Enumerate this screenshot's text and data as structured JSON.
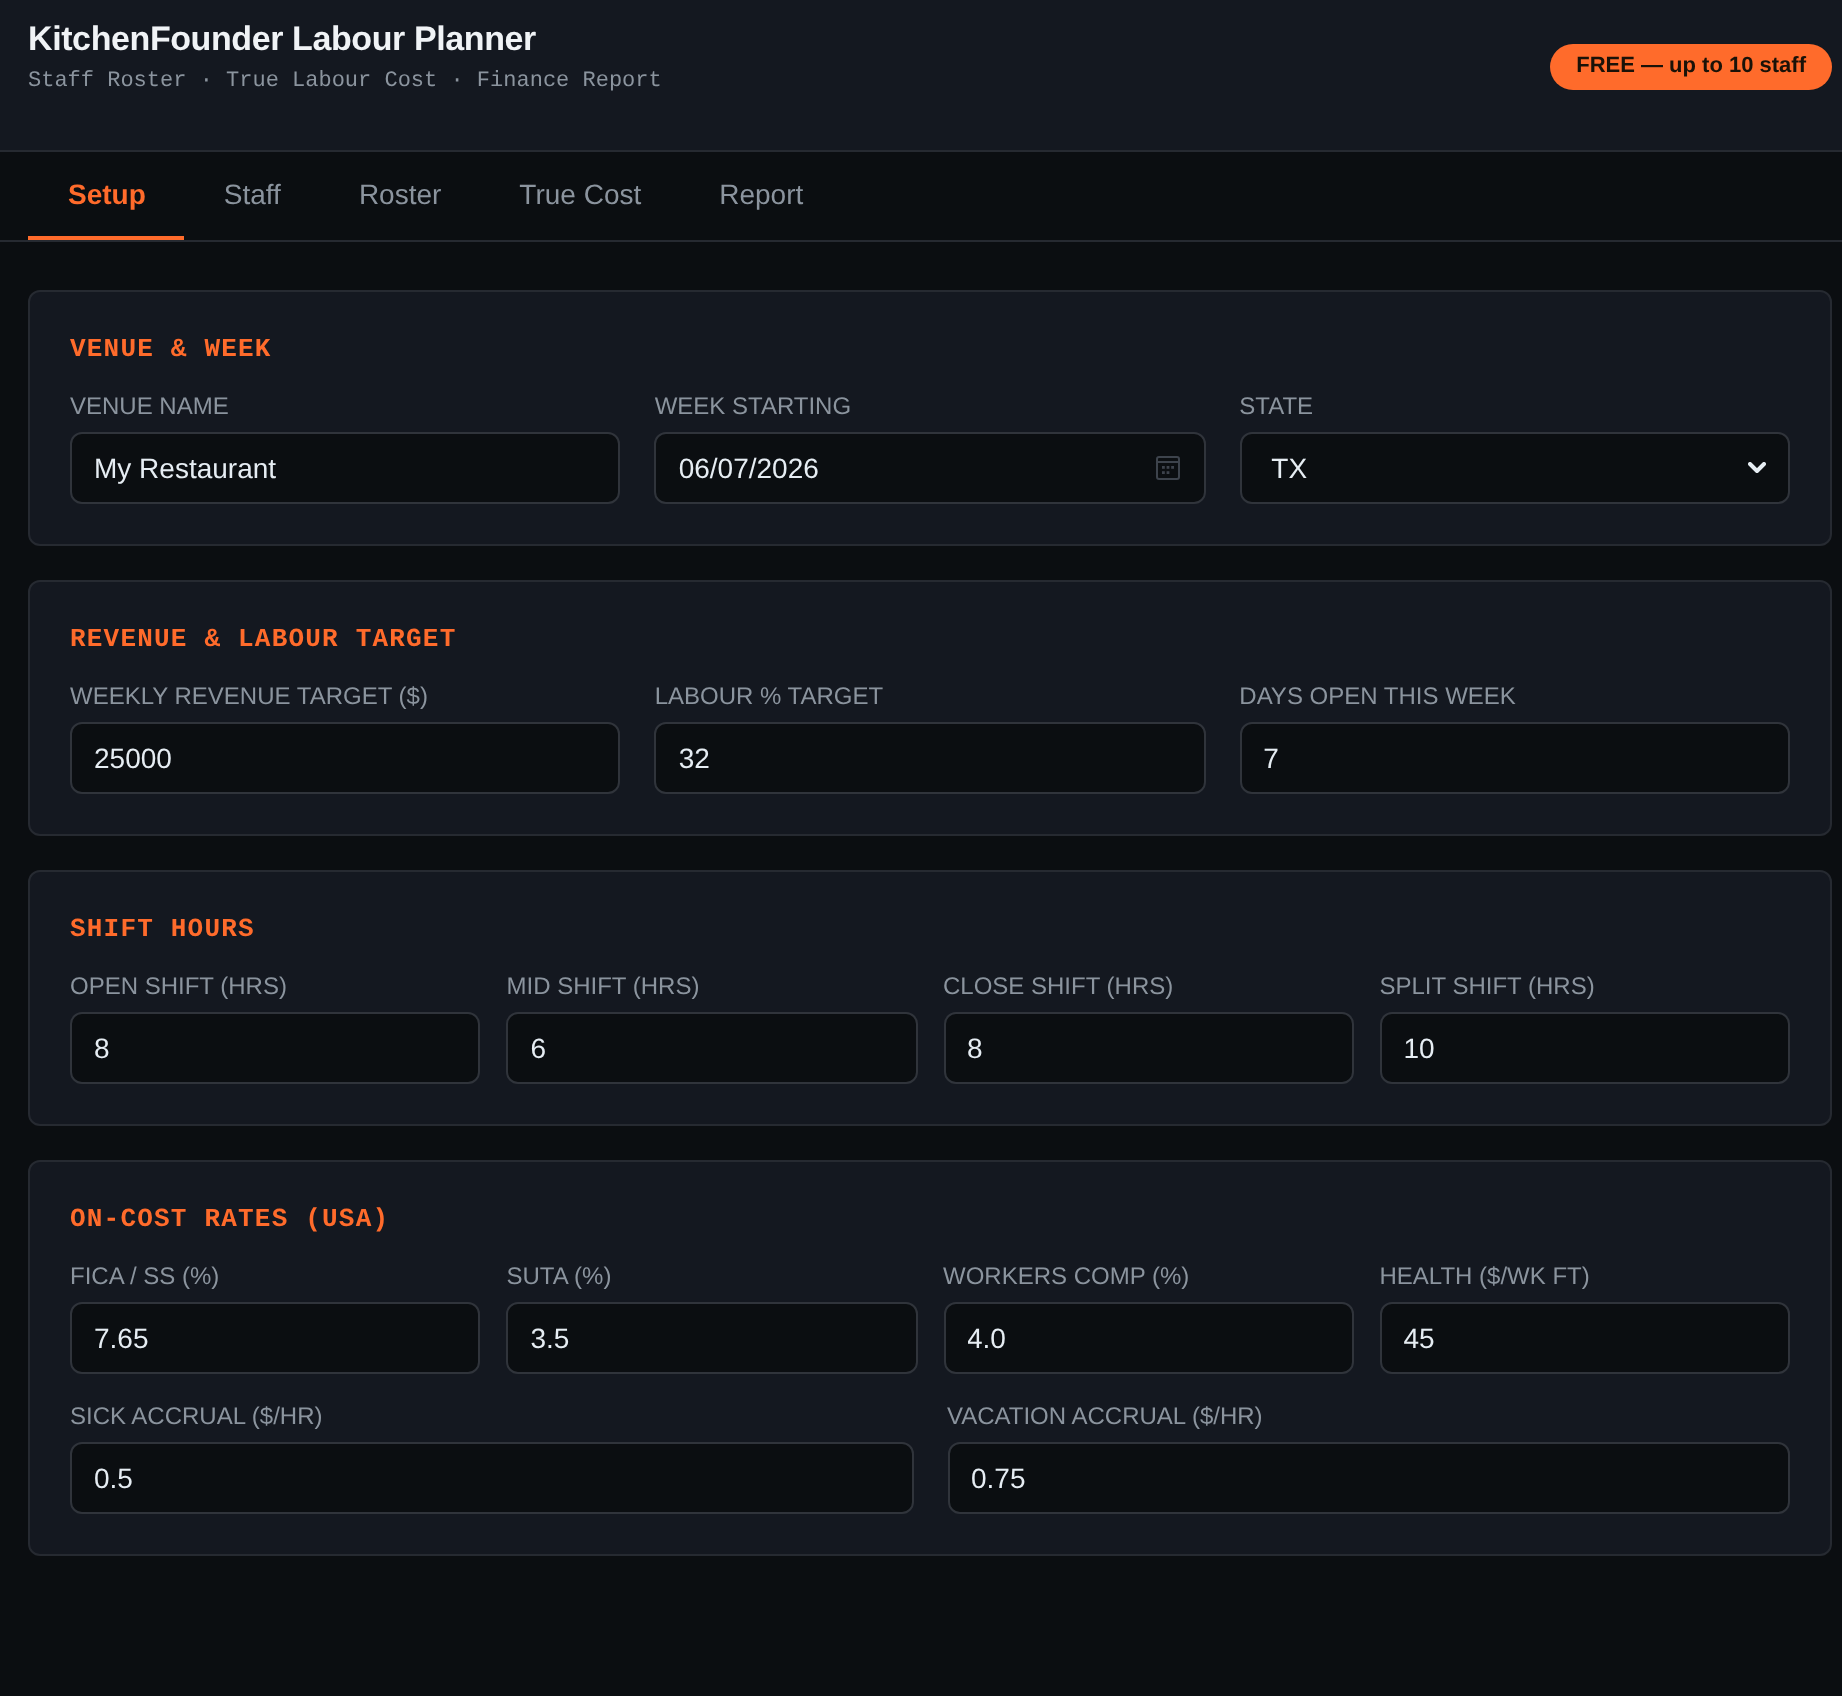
{
  "header": {
    "title": "KitchenFounder Labour Planner",
    "subtitle": "Staff Roster · True Labour Cost · Finance Report",
    "badge": "FREE — up to 10 staff"
  },
  "tabs": [
    {
      "label": "Setup",
      "selected": true
    },
    {
      "label": "Staff",
      "selected": false
    },
    {
      "label": "Roster",
      "selected": false
    },
    {
      "label": "True Cost",
      "selected": false
    },
    {
      "label": "Report",
      "selected": false
    }
  ],
  "sections": [
    {
      "title": "VENUE & WEEK",
      "rows": [
        {
          "fields": [
            {
              "label": "VENUE NAME",
              "kind": "text",
              "value": "My Restaurant"
            },
            {
              "label": "WEEK STARTING",
              "kind": "date",
              "value": "06/07/2026"
            },
            {
              "label": "STATE",
              "kind": "select",
              "value": "TX"
            }
          ]
        }
      ]
    },
    {
      "title": "REVENUE & LABOUR TARGET",
      "rows": [
        {
          "fields": [
            {
              "label": "WEEKLY REVENUE TARGET ($)",
              "kind": "text",
              "value": "25000"
            },
            {
              "label": "LABOUR % TARGET",
              "kind": "text",
              "value": "32"
            },
            {
              "label": "DAYS OPEN THIS WEEK",
              "kind": "text",
              "value": "7"
            }
          ]
        }
      ]
    },
    {
      "title": "SHIFT HOURS",
      "rows": [
        {
          "fields": [
            {
              "label": "OPEN SHIFT (HRS)",
              "kind": "text",
              "value": "8"
            },
            {
              "label": "MID SHIFT (HRS)",
              "kind": "text",
              "value": "6"
            },
            {
              "label": "CLOSE SHIFT (HRS)",
              "kind": "text",
              "value": "8"
            },
            {
              "label": "SPLIT SHIFT (HRS)",
              "kind": "text",
              "value": "10"
            }
          ]
        }
      ]
    },
    {
      "title": "ON-COST RATES (USA)",
      "rows": [
        {
          "fields": [
            {
              "label": "FICA / SS (%)",
              "kind": "text",
              "value": "7.65"
            },
            {
              "label": "SUTA (%)",
              "kind": "text",
              "value": "3.5"
            },
            {
              "label": "WORKERS COMP (%)",
              "kind": "text",
              "value": "4.0"
            },
            {
              "label": "HEALTH ($/WK FT)",
              "kind": "text",
              "value": "45"
            }
          ]
        },
        {
          "fields": [
            {
              "label": "SICK ACCRUAL ($/HR)",
              "kind": "text",
              "value": "0.5"
            },
            {
              "label": "VACATION ACCRUAL ($/HR)",
              "kind": "text",
              "value": "0.75"
            }
          ]
        }
      ]
    }
  ]
}
